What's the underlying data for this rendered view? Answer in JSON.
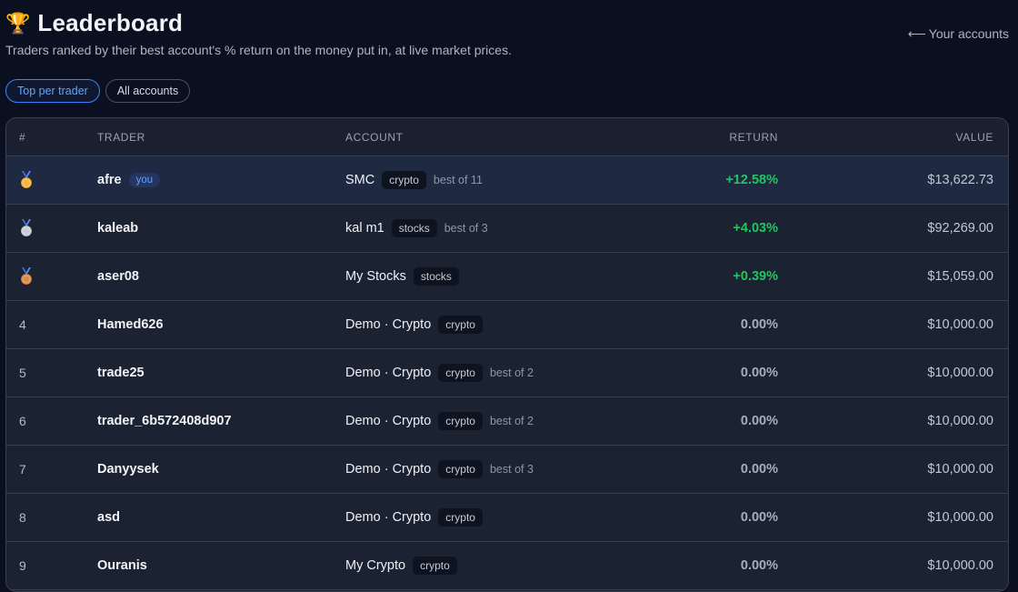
{
  "header": {
    "trophy": "🏆",
    "title": "Leaderboard",
    "subtitle": "Traders ranked by their best account's % return on the money put in, at live market prices.",
    "back_arrow": "⟵",
    "back_label": "Your accounts"
  },
  "filters": {
    "top_per_trader": "Top per trader",
    "all_accounts": "All accounts",
    "active": "top_per_trader"
  },
  "table": {
    "columns": {
      "rank": "#",
      "trader": "TRADER",
      "account": "ACCOUNT",
      "return": "RETURN",
      "value": "VALUE"
    },
    "rows": [
      {
        "rank": "1",
        "medal": "gold",
        "trader": "afre",
        "you": "you",
        "account": "SMC",
        "tag": "crypto",
        "best": "best of 11",
        "return": "+12.58%",
        "value": "$13,622.73"
      },
      {
        "rank": "2",
        "medal": "silver",
        "trader": "kaleab",
        "you": "",
        "account": "kal m1",
        "tag": "stocks",
        "best": "best of 3",
        "return": "+4.03%",
        "value": "$92,269.00"
      },
      {
        "rank": "3",
        "medal": "bronze",
        "trader": "aser08",
        "you": "",
        "account": "My Stocks",
        "tag": "stocks",
        "best": "",
        "return": "+0.39%",
        "value": "$15,059.00"
      },
      {
        "rank": "4",
        "medal": "",
        "trader": "Hamed626",
        "you": "",
        "account": "Demo · Crypto",
        "tag": "crypto",
        "best": "",
        "return": "0.00%",
        "value": "$10,000.00"
      },
      {
        "rank": "5",
        "medal": "",
        "trader": "trade25",
        "you": "",
        "account": "Demo · Crypto",
        "tag": "crypto",
        "best": "best of 2",
        "return": "0.00%",
        "value": "$10,000.00"
      },
      {
        "rank": "6",
        "medal": "",
        "trader": "trader_6b572408d907",
        "you": "",
        "account": "Demo · Crypto",
        "tag": "crypto",
        "best": "best of 2",
        "return": "0.00%",
        "value": "$10,000.00"
      },
      {
        "rank": "7",
        "medal": "",
        "trader": "Danyysek",
        "you": "",
        "account": "Demo · Crypto",
        "tag": "crypto",
        "best": "best of 3",
        "return": "0.00%",
        "value": "$10,000.00"
      },
      {
        "rank": "8",
        "medal": "",
        "trader": "asd",
        "you": "",
        "account": "Demo · Crypto",
        "tag": "crypto",
        "best": "",
        "return": "0.00%",
        "value": "$10,000.00"
      },
      {
        "rank": "9",
        "medal": "",
        "trader": "Ouranis",
        "you": "",
        "account": "My Crypto",
        "tag": "crypto",
        "best": "",
        "return": "0.00%",
        "value": "$10,000.00"
      }
    ]
  },
  "colors": {
    "background": "#0b1020",
    "accent": "#3b82f6",
    "positive": "#22c55e",
    "gold": "#f4b63c",
    "silver": "#c8cdd8",
    "bronze": "#d98b4a"
  }
}
